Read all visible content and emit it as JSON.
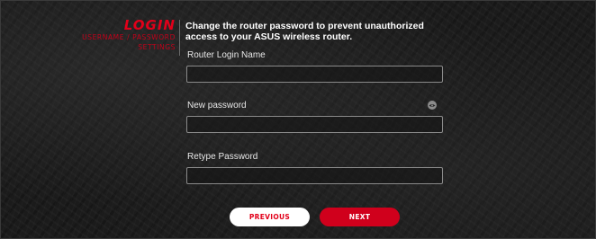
{
  "sidebar": {
    "title": "LOGIN",
    "subtitle": "USERNAME / PASSWORD",
    "subtitle2": "SETTINGS"
  },
  "description": "Change the router password to prevent unauthorized access to your ASUS wireless router.",
  "fields": {
    "login_name": {
      "label": "Router Login Name",
      "value": ""
    },
    "new_password": {
      "label": "New password",
      "value": ""
    },
    "retype_password": {
      "label": "Retype Password",
      "value": ""
    }
  },
  "icons": {
    "password_toggle": "eye-icon"
  },
  "buttons": {
    "previous": "PREVIOUS",
    "next": "NEXT"
  },
  "colors": {
    "accent": "#e2001a",
    "button_next_bg": "#d0001c",
    "button_prev_bg": "#ffffff",
    "background": "#1b1b1b"
  }
}
